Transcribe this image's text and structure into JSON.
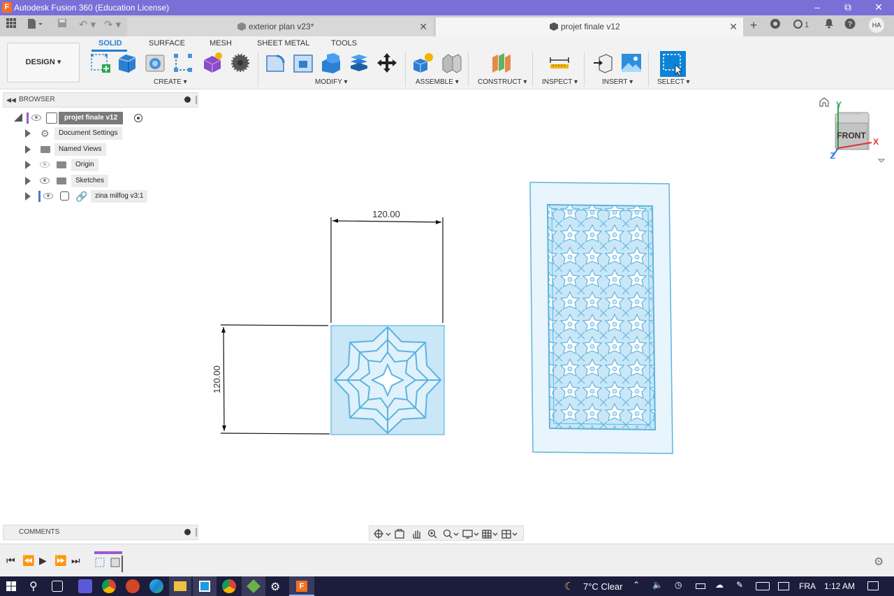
{
  "window": {
    "title": "Autodesk Fusion 360 (Education License)",
    "app_icon_letter": "F"
  },
  "tabs": [
    {
      "label": "exterior plan v23*",
      "active": false
    },
    {
      "label": "projet finale v12",
      "active": true
    }
  ],
  "tabbar_icons": {
    "jobs_count": "1",
    "user_initials": "HA"
  },
  "workspace": {
    "label": "DESIGN"
  },
  "toolbar_tabs": [
    "SOLID",
    "SURFACE",
    "MESH",
    "SHEET METAL",
    "TOOLS"
  ],
  "toolbar_groups": {
    "create": "CREATE",
    "modify": "MODIFY",
    "assemble": "ASSEMBLE",
    "construct": "CONSTRUCT",
    "inspect": "INSPECT",
    "insert": "INSERT",
    "select": "SELECT"
  },
  "browser": {
    "title": "BROWSER",
    "root": "projet finale v12",
    "items": [
      {
        "label": "Document Settings",
        "icon": "gear-icon"
      },
      {
        "label": "Named Views",
        "icon": "folder-icon"
      },
      {
        "label": "Origin",
        "icon": "folder-icon"
      },
      {
        "label": "Sketches",
        "icon": "folder-icon"
      },
      {
        "label": "zina milfog v3:1",
        "icon": "link-icon"
      }
    ]
  },
  "comments": {
    "title": "COMMENTS"
  },
  "canvas": {
    "dimension_horizontal": "120.00",
    "dimension_vertical": "120.00"
  },
  "viewcube": {
    "face": "FRONT",
    "axis_x": "X",
    "axis_y": "Y",
    "axis_z": "Z"
  },
  "taskbar": {
    "weather": "7°C  Clear",
    "language": "FRA",
    "time": "1:12 AM"
  },
  "colors": {
    "title_bar": "#7a6fd6",
    "accent": "#1f7fd6",
    "sketch_fill": "#c9e7f7",
    "sketch_stroke": "#5cb3e0",
    "taskbar": "#1c1c3c"
  }
}
